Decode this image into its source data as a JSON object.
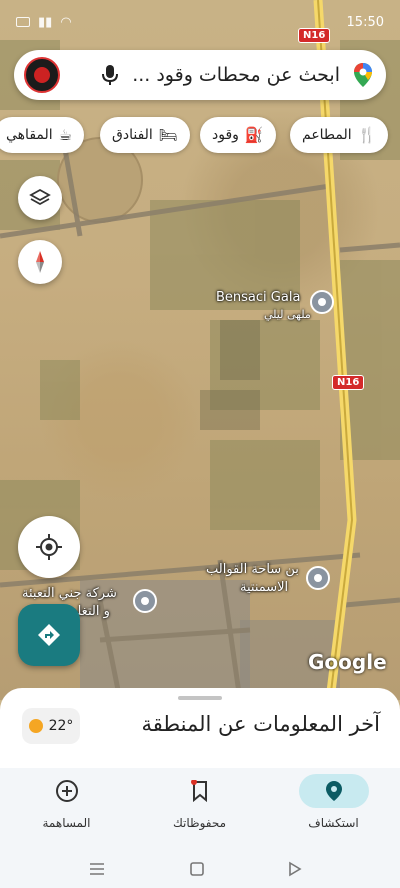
{
  "status": {
    "time": "15:50"
  },
  "search": {
    "placeholder": "ابحث عن محطات وقود ..."
  },
  "chips": [
    {
      "label": "المطاعم",
      "icon": "restaurant-icon"
    },
    {
      "label": "وقود",
      "icon": "gas-station-icon"
    },
    {
      "label": "الفنادق",
      "icon": "hotel-icon"
    },
    {
      "label": "المقاهي",
      "icon": "cafe-icon"
    }
  ],
  "map": {
    "places": [
      {
        "name": "Bensaci Gala",
        "subtitle": "ملهى ليلي"
      },
      {
        "name": "بن ساحة القوالب",
        "subtitle": "الاسمنتية"
      },
      {
        "name": "شركة جني التعبئة",
        "subtitle": "و التغليف"
      }
    ],
    "road_label": "N16",
    "brand": "Google"
  },
  "sheet": {
    "title": "آخر المعلومات عن المنطقة",
    "temperature": "22°"
  },
  "bottom_nav": [
    {
      "label": "استكشاف",
      "icon": "explore-pin-icon",
      "active": true
    },
    {
      "label": "محفوظاتك",
      "icon": "saved-bookmark-icon",
      "active": false
    },
    {
      "label": "المساهمة",
      "icon": "contribute-plus-icon",
      "active": false
    }
  ]
}
